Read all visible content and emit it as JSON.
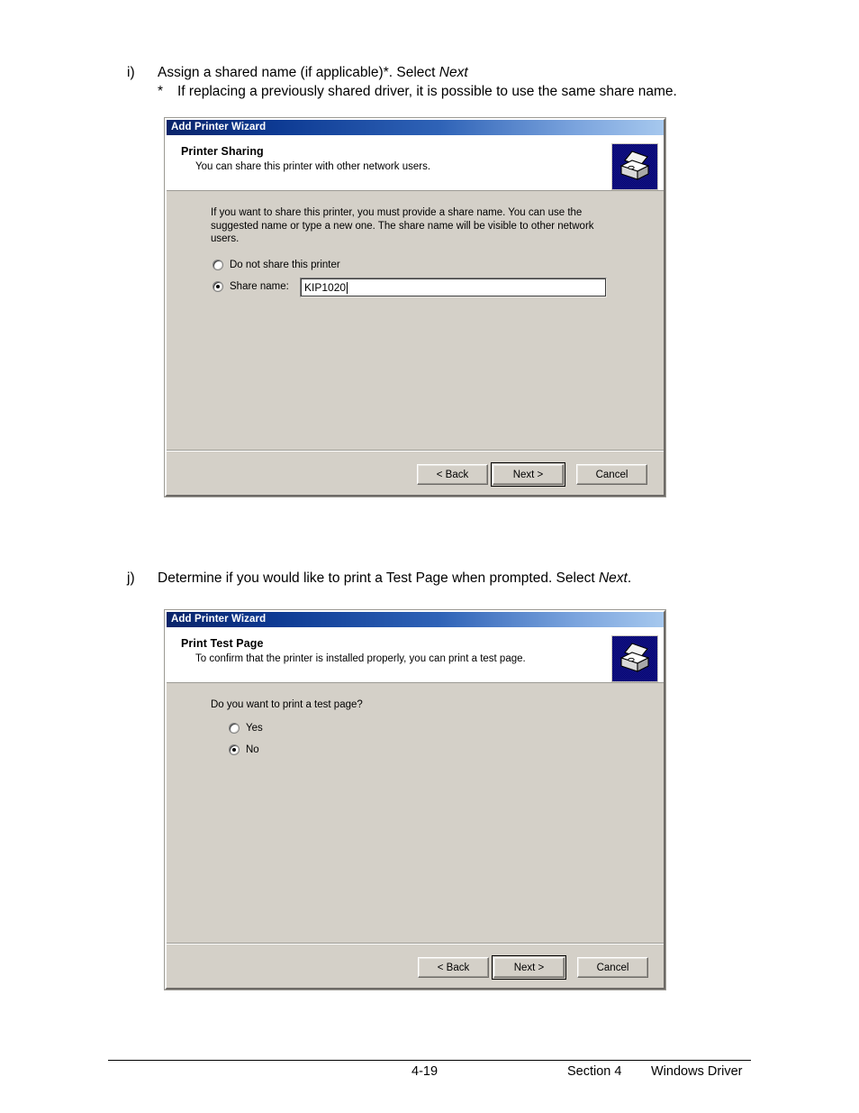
{
  "page": {
    "steps": [
      {
        "marker": "i)",
        "line": "Assign a shared name (if applicable)*. Select ",
        "line_italic": "Next",
        "sub_marker": "*",
        "sub_text": "If replacing a previously shared driver, it is possible to use the same share name."
      },
      {
        "marker": "j)",
        "line": "Determine if you would like to print a Test Page when prompted. Select ",
        "line_italic": "Next",
        "line_tail": "."
      }
    ],
    "footer": {
      "page_number": "4-19",
      "section": "Section 4",
      "chapter": "Windows Driver"
    }
  },
  "dialog_sharing": {
    "titlebar": {
      "title": "Add Printer Wizard"
    },
    "header": {
      "title": "Printer Sharing",
      "subtitle": "You can share this printer with other network users.",
      "icon": "printer-icon"
    },
    "body": {
      "description": "If you want to share this printer, you must provide a share name. You can use the suggested name or type a new one. The share name will be visible to other network users.",
      "options": [
        {
          "label": "Do not share this printer",
          "checked": false
        },
        {
          "label": "Share name:",
          "checked": true
        }
      ],
      "share_name_field": {
        "value": "KIP1020",
        "placeholder": ""
      }
    },
    "buttons": [
      {
        "label": "< Back",
        "default": false
      },
      {
        "label": "Next >",
        "default": true
      },
      {
        "label": "Cancel",
        "default": false
      }
    ]
  },
  "dialog_test_page": {
    "titlebar": {
      "title": "Add Printer Wizard"
    },
    "header": {
      "title": "Print Test Page",
      "subtitle": "To confirm that the printer is installed properly, you can print a test page.",
      "icon": "printer-icon"
    },
    "body": {
      "question": "Do you want to print a test page?",
      "options": [
        {
          "label": "Yes",
          "checked": false
        },
        {
          "label": "No",
          "checked": true
        }
      ]
    },
    "buttons": [
      {
        "label": "< Back",
        "default": false
      },
      {
        "label": "Next >",
        "default": true
      },
      {
        "label": "Cancel",
        "default": false
      }
    ]
  },
  "colors": {
    "titlebar_start": "#0a246a",
    "titlebar_end": "#a6c8ee",
    "dialog_face": "#d4d0c8",
    "icon_background": "#00006b",
    "text": "#000000"
  }
}
